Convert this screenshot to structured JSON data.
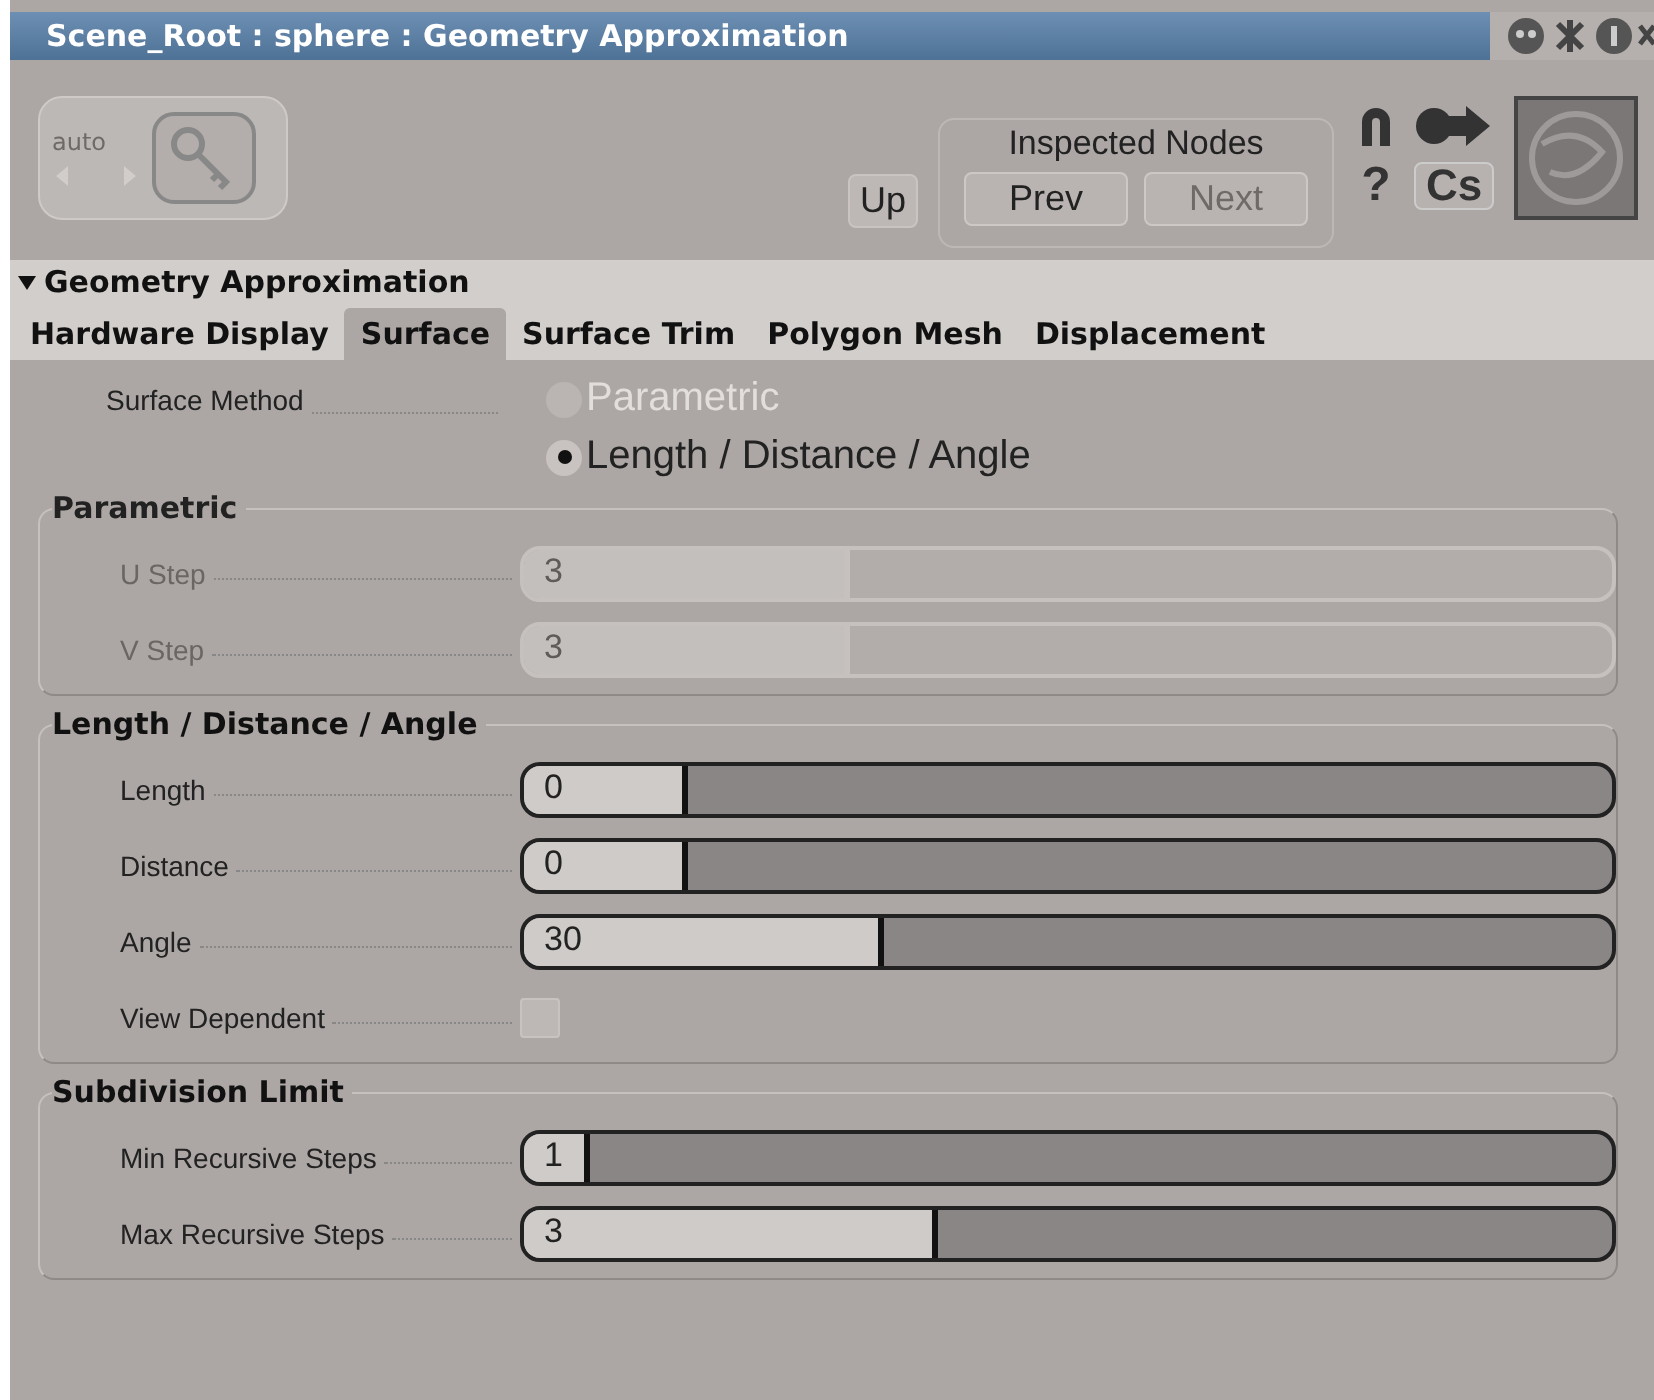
{
  "window": {
    "title": "Scene_Root : sphere : Geometry Approximation"
  },
  "toolbar": {
    "auto_label": "auto",
    "up_button": "Up",
    "inspected_nodes": {
      "label": "Inspected Nodes",
      "buttons": [
        {
          "label": "Prev",
          "disabled": false
        },
        {
          "label": "Next",
          "disabled": true
        }
      ]
    },
    "help_button": "?",
    "cs_button": "Cs"
  },
  "section": {
    "title": "Geometry Approximation",
    "expanded": true
  },
  "tabs": [
    {
      "label": "Hardware Display",
      "selected": false
    },
    {
      "label": "Surface",
      "selected": true
    },
    {
      "label": "Surface Trim",
      "selected": false
    },
    {
      "label": "Polygon Mesh",
      "selected": false
    },
    {
      "label": "Displacement",
      "selected": false
    }
  ],
  "surface_method": {
    "label": "Surface Method",
    "options": [
      {
        "label": "Parametric",
        "selected": false,
        "disabled": true
      },
      {
        "label": "Length / Distance / Angle",
        "selected": true,
        "disabled": false
      }
    ]
  },
  "groups": [
    {
      "title": "Parametric",
      "disabled": true,
      "rows": [
        {
          "kind": "slider",
          "label": "U Step",
          "value": "3",
          "level": 0.3
        },
        {
          "kind": "slider",
          "label": "V Step",
          "value": "3",
          "level": 0.3
        }
      ]
    },
    {
      "title": "Length / Distance / Angle",
      "disabled": false,
      "rows": [
        {
          "kind": "slider",
          "label": "Length",
          "value": "0",
          "level": 0.15
        },
        {
          "kind": "slider",
          "label": "Distance",
          "value": "0",
          "level": 0.15
        },
        {
          "kind": "slider",
          "label": "Angle",
          "value": "30",
          "level": 0.33
        },
        {
          "kind": "checkbox",
          "label": "View Dependent",
          "checked": false
        }
      ]
    },
    {
      "title": "Subdivision Limit",
      "disabled": false,
      "rows": [
        {
          "kind": "slider",
          "label": "Min Recursive Steps",
          "value": "1",
          "level": 0.06
        },
        {
          "kind": "slider",
          "label": "Max Recursive Steps",
          "value": "3",
          "level": 0.38
        }
      ]
    }
  ]
}
